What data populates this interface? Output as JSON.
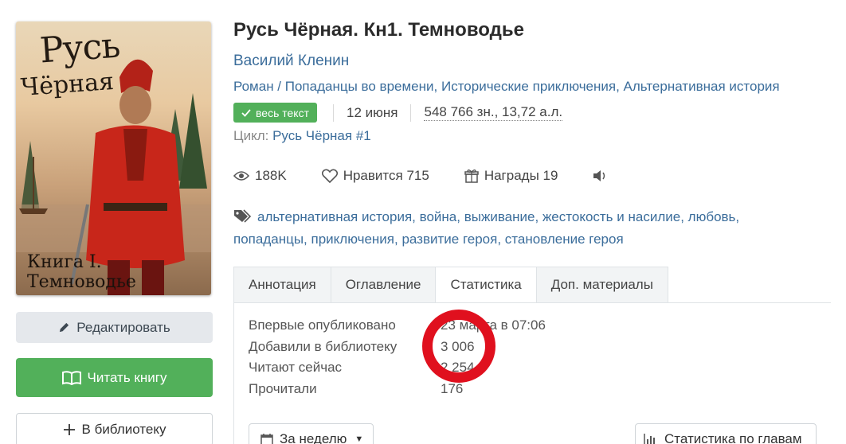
{
  "book": {
    "title": "Русь Чёрная. Кн1. Темноводье",
    "author": "Василий Кленин",
    "genres": [
      "Роман / Попаданцы во времени",
      "Исторические приключения",
      "Альтернативная история"
    ],
    "full_text_badge": "весь текст",
    "date": "12 июня",
    "size": "548 766 зн., 13,72 а.л.",
    "cycle_label": "Цикл:",
    "cycle_value": "Русь Чёрная #1"
  },
  "cover": {
    "title_line1": "Русь",
    "title_line2": "Чёрная",
    "subtitle": "Книга I. Темноводье"
  },
  "stats_bar": {
    "views": "188K",
    "likes": "Нравится 715",
    "awards": "Награды 19"
  },
  "tags": [
    "альтернативная история",
    "война",
    "выживание",
    "жестокость и насилие",
    "любовь",
    "попаданцы",
    "приключения",
    "развитие героя",
    "становление героя"
  ],
  "buttons": {
    "edit": "Редактировать",
    "read": "Читать книгу",
    "library": "В библиотеку"
  },
  "tabs": [
    {
      "label": "Аннотация",
      "active": false
    },
    {
      "label": "Оглавление",
      "active": false
    },
    {
      "label": "Статистика",
      "active": true
    },
    {
      "label": "Доп. материалы",
      "active": false
    }
  ],
  "statistics": {
    "rows": [
      {
        "label": "Впервые опубликовано",
        "value": "23 марта в 07:06"
      },
      {
        "label": "Добавили в библиотеку",
        "value": "3 006"
      },
      {
        "label": "Читают сейчас",
        "value": "2 254"
      },
      {
        "label": "Прочитали",
        "value": "176"
      }
    ],
    "period_select": "За неделю",
    "chapters_button": "Статистика по главам"
  },
  "colors": {
    "link": "#3b6d9b",
    "green": "#52b05a",
    "highlight_circle": "#e0101e"
  }
}
